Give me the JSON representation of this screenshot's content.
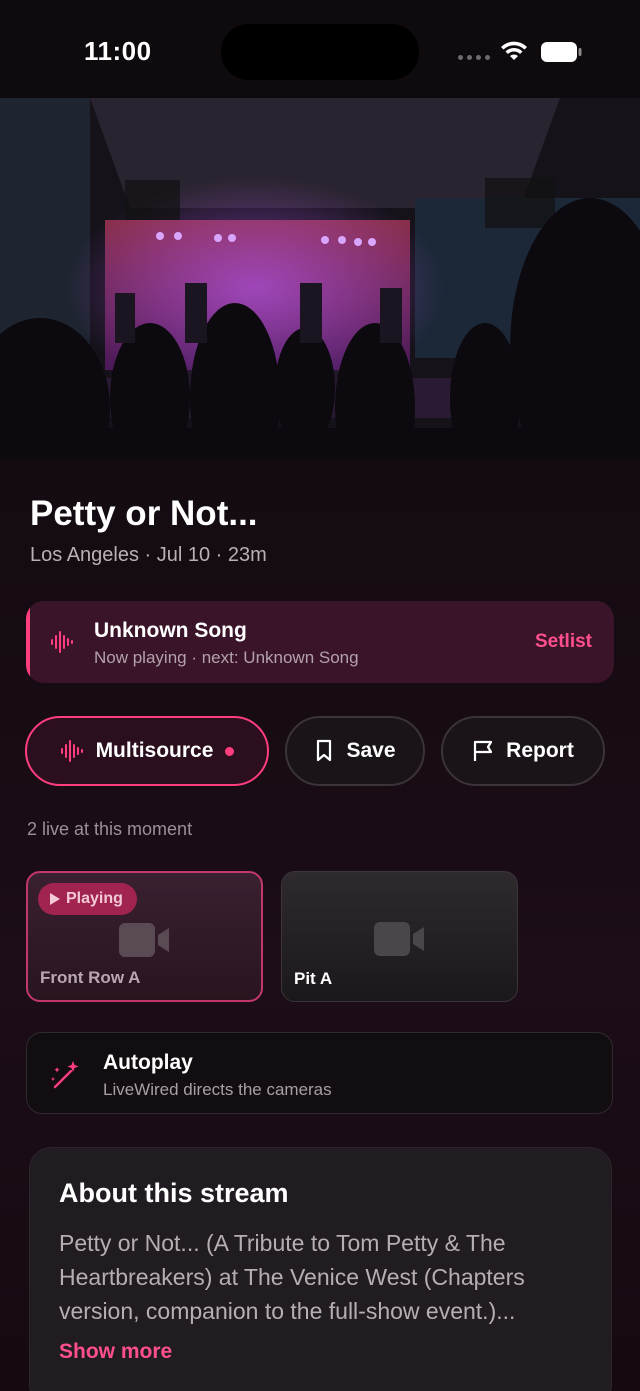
{
  "status_bar": {
    "time": "11:00",
    "wifi_icon": "wifi-icon",
    "battery_icon": "battery-icon"
  },
  "hero": {
    "icon": "concert-video-frame"
  },
  "stream": {
    "title": "Petty or Not...",
    "meta": "Los Angeles · Jul 10 · 23m"
  },
  "now_playing": {
    "icon": "audio-wave-icon",
    "song": "Unknown Song",
    "subtitle": "Now playing · next: Unknown Song",
    "setlist_label": "Setlist"
  },
  "actions": {
    "multisource_label": "Multisource",
    "save_label": "Save",
    "report_label": "Report"
  },
  "live_count": "2 live at this moment",
  "cameras": [
    {
      "label": "Front Row A",
      "badge": "Playing",
      "active": true,
      "icon": "video-camera-icon"
    },
    {
      "label": "Pit A",
      "active": false,
      "icon": "video-camera-icon"
    }
  ],
  "autoplay": {
    "icon": "magic-wand-icon",
    "title": "Autoplay",
    "subtitle": "LiveWired directs the cameras"
  },
  "about": {
    "title": "About this stream",
    "body": "Petty or Not... (A Tribute to Tom Petty & The Heartbreakers) at The Venice West (Chapters version, companion to the full-show event.)...",
    "show_more": "Show more"
  },
  "colors": {
    "accent": "#ff3d7f",
    "background": "#150b12"
  }
}
